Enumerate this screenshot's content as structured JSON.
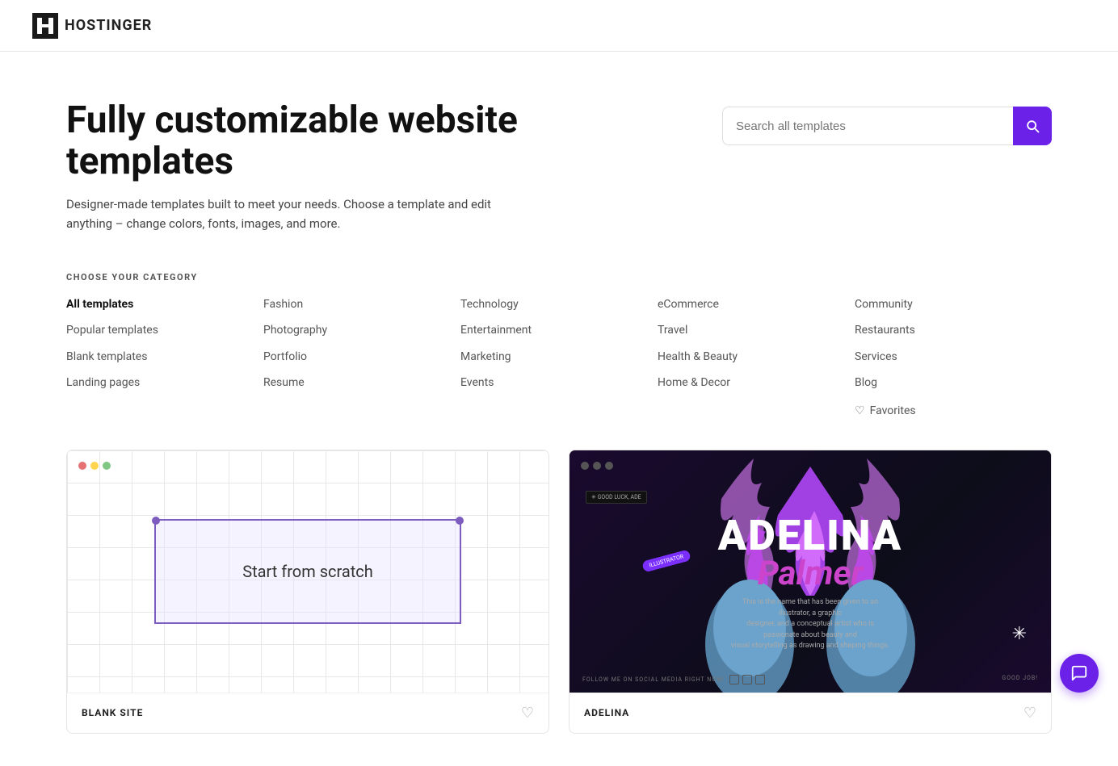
{
  "header": {
    "logo_text": "HOSTINGER"
  },
  "hero": {
    "title": "Fully customizable website templates",
    "subtitle": "Designer-made templates built to meet your needs. Choose a template and edit anything – change colors, fonts, images, and more.",
    "search_placeholder": "Search all templates"
  },
  "categories": {
    "label": "CHOOSE YOUR CATEGORY",
    "favorites_label": "Favorites",
    "columns": [
      {
        "items": [
          {
            "label": "All templates",
            "active": true
          },
          {
            "label": "Popular templates",
            "active": false
          },
          {
            "label": "Blank templates",
            "active": false
          },
          {
            "label": "Landing pages",
            "active": false
          }
        ]
      },
      {
        "items": [
          {
            "label": "Fashion",
            "active": false
          },
          {
            "label": "Photography",
            "active": false
          },
          {
            "label": "Portfolio",
            "active": false
          },
          {
            "label": "Resume",
            "active": false
          }
        ]
      },
      {
        "items": [
          {
            "label": "Technology",
            "active": false
          },
          {
            "label": "Entertainment",
            "active": false
          },
          {
            "label": "Marketing",
            "active": false
          },
          {
            "label": "Events",
            "active": false
          }
        ]
      },
      {
        "items": [
          {
            "label": "eCommerce",
            "active": false
          },
          {
            "label": "Travel",
            "active": false
          },
          {
            "label": "Health & Beauty",
            "active": false
          },
          {
            "label": "Home & Decor",
            "active": false
          }
        ]
      },
      {
        "items": [
          {
            "label": "Community",
            "active": false
          },
          {
            "label": "Restaurants",
            "active": false
          },
          {
            "label": "Services",
            "active": false
          },
          {
            "label": "Blog",
            "active": false
          }
        ]
      }
    ]
  },
  "templates": [
    {
      "name": "BLANK SITE",
      "label": "Start from scratch",
      "type": "blank"
    },
    {
      "name": "ADELINA",
      "type": "adelina",
      "adelina_name": "ADELINA",
      "adelina_surname": "Palmer",
      "good_luck": "GOOD LUCK, ADE",
      "badge": "ILLUSTRATOR",
      "footer_left": "FOLLOW ME ON SOCIAL MEDIA RIGHT NOW!",
      "footer_right": "GOOD JOB!"
    }
  ]
}
